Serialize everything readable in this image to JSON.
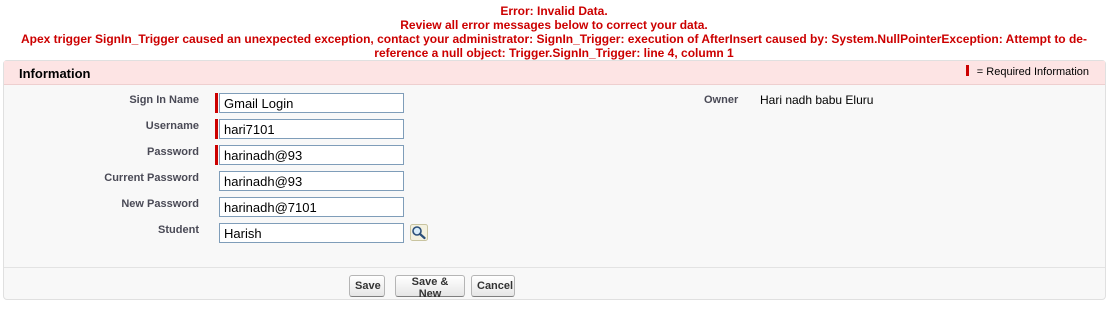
{
  "errors": {
    "line1": "Error: Invalid Data.",
    "line2": "Review all error messages below to correct your data.",
    "line3": "Apex trigger SignIn_Trigger caused an unexpected exception, contact your administrator: SignIn_Trigger: execution of AfterInsert caused by: System.NullPointerException: Attempt to de-reference a null object: Trigger.SignIn_Trigger: line 4, column 1"
  },
  "section": {
    "title": "Information",
    "required_legend": "= Required Information"
  },
  "fields": {
    "sign_in_name": {
      "label": "Sign In Name",
      "value": "Gmail Login"
    },
    "username": {
      "label": "Username",
      "value": "hari7101"
    },
    "password": {
      "label": "Password",
      "value": "harinadh@93"
    },
    "current_password": {
      "label": "Current Password",
      "value": "harinadh@93"
    },
    "new_password": {
      "label": "New Password",
      "value": "harinadh@7101"
    },
    "student": {
      "label": "Student",
      "value": "Harish"
    }
  },
  "owner": {
    "label": "Owner",
    "value": "Hari nadh babu Eluru"
  },
  "icons": {
    "lookup": "lookup-magnifier-icon",
    "required": "required-bar"
  },
  "colors": {
    "error": "#cc0000",
    "header_bg": "#fde4e4",
    "required": "#cc0000"
  },
  "buttons": {
    "save": "Save",
    "save_new": "Save & New",
    "cancel": "Cancel"
  }
}
